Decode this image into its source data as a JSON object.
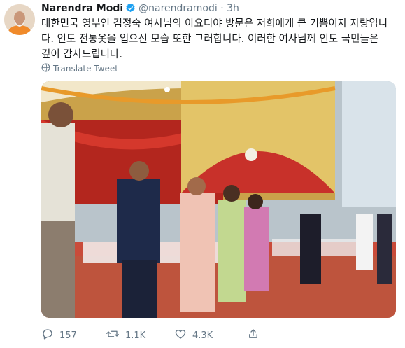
{
  "author": {
    "name": "Narendra Modi",
    "handle": "@narendramodi",
    "time": "3h"
  },
  "tweet": {
    "text": "대한민국 영부인 김정숙 여사님의 아요디야 방문은 저희에게 큰 기쁨이자 자랑입니다. 인도 전통옷을 입으신 모습 또한 그러합니다. 이러한 여사님께 인도 국민들은 깊이 감사드립니다.",
    "translate_label": "Translate Tweet"
  },
  "actions": {
    "replies": "157",
    "retweets": "1.1K",
    "likes": "4.3K"
  },
  "icons": {
    "verified": "verified-badge-icon",
    "translate": "globe-icon",
    "reply": "reply-icon",
    "retweet": "retweet-icon",
    "like": "heart-icon",
    "share": "share-icon"
  },
  "colors": {
    "verified": "#1da1f2",
    "secondary_text": "#657786",
    "primary_text": "#14171a"
  }
}
